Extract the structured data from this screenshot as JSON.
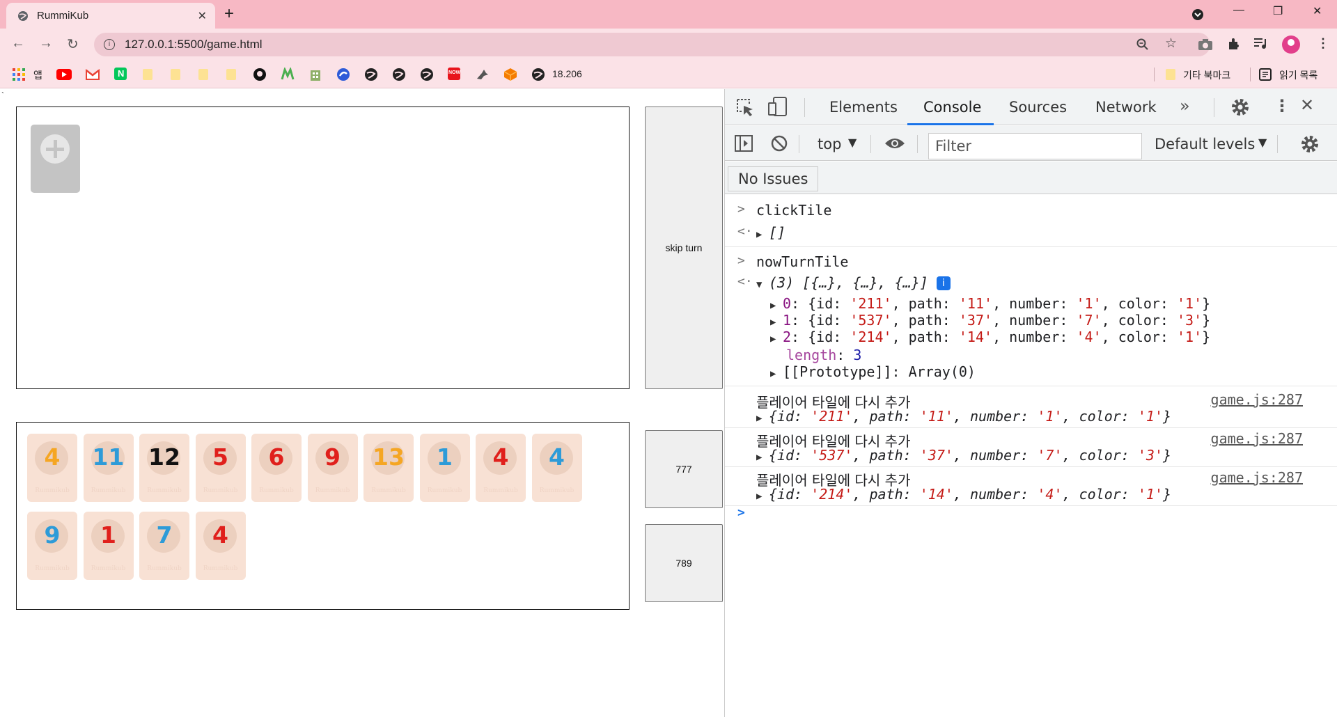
{
  "browser": {
    "tab_title": "RummiKub",
    "url": "127.0.0.1:5500/game.html",
    "bookmarks": {
      "apps_label": "앱",
      "ip_label": "18.206",
      "other_bookmarks": "기타 북마크",
      "reading_list": "읽기 목록"
    }
  },
  "game": {
    "skip_button": "skip turn",
    "button_2": "777",
    "button_3": "789",
    "tile_brand": "Rummikub",
    "colors": {
      "orange": "#f5a623",
      "blue": "#2d9bd8",
      "black": "#111111",
      "red": "#e0201c"
    },
    "hand_tiles": [
      {
        "number": "4",
        "color": "orange"
      },
      {
        "number": "11",
        "color": "blue"
      },
      {
        "number": "12",
        "color": "black"
      },
      {
        "number": "5",
        "color": "red"
      },
      {
        "number": "6",
        "color": "red"
      },
      {
        "number": "9",
        "color": "red"
      },
      {
        "number": "13",
        "color": "orange"
      },
      {
        "number": "1",
        "color": "blue"
      },
      {
        "number": "4",
        "color": "red"
      },
      {
        "number": "4",
        "color": "blue"
      },
      {
        "number": "9",
        "color": "blue"
      },
      {
        "number": "1",
        "color": "red"
      },
      {
        "number": "7",
        "color": "blue"
      },
      {
        "number": "4",
        "color": "red"
      }
    ]
  },
  "devtools": {
    "tabs": [
      "Elements",
      "Console",
      "Sources",
      "Network"
    ],
    "active_tab": "Console",
    "context": "top",
    "filter_placeholder": "Filter",
    "levels": "Default levels",
    "issues": "No Issues",
    "console": {
      "cmd1": "clickTile",
      "res1": "[]",
      "cmd2": "nowTurnTile",
      "array_summary": "(3) [{…}, {…}, {…}]",
      "items": [
        {
          "index": "0",
          "id": "'211'",
          "path": "'11'",
          "number": "'1'",
          "color": "'1'"
        },
        {
          "index": "1",
          "id": "'537'",
          "path": "'37'",
          "number": "'7'",
          "color": "'3'"
        },
        {
          "index": "2",
          "id": "'214'",
          "path": "'14'",
          "number": "'4'",
          "color": "'1'"
        }
      ],
      "length_label": "length",
      "length_value": "3",
      "prototype_label": "[[Prototype]]",
      "prototype_value": "Array(0)",
      "log_message": "플레이어 타일에 다시 추가",
      "log_source": "game.js:287"
    }
  }
}
